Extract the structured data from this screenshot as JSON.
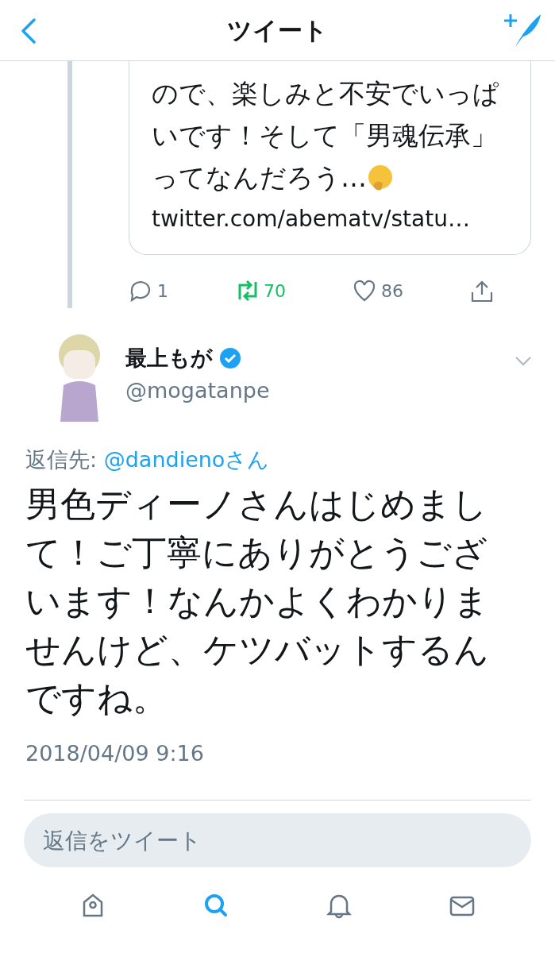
{
  "header": {
    "title": "ツイート"
  },
  "quoted_tweet": {
    "text": "ので、楽しみと不安でいっぱいです！そして「男魂伝承」ってなんだろう…",
    "link": "twitter.com/abematv/statu…"
  },
  "actions": [
    {
      "kind": "reply",
      "count": "1",
      "active": false
    },
    {
      "kind": "retweet",
      "count": "70",
      "active": true
    },
    {
      "kind": "like",
      "count": "86",
      "active": false
    },
    {
      "kind": "share"
    }
  ],
  "tweet": {
    "name": "最上もが",
    "verified": true,
    "handle": "@mogatanpe",
    "reply_to_label": "返信先:",
    "reply_to": "@dandienoさん",
    "text": "男色ディーノさんはじめまして！ご丁寧にありがとうございます！なんかよくわかりませんけど、ケツバットするんですね。",
    "timestamp": "2018/04/09 9:16"
  },
  "reply_field": {
    "placeholder": "返信をツイート"
  },
  "tab_bar": [
    {
      "kind": "home",
      "selected": false
    },
    {
      "kind": "search",
      "selected": true
    },
    {
      "kind": "notifications",
      "selected": false
    },
    {
      "kind": "messages",
      "selected": false
    }
  ]
}
